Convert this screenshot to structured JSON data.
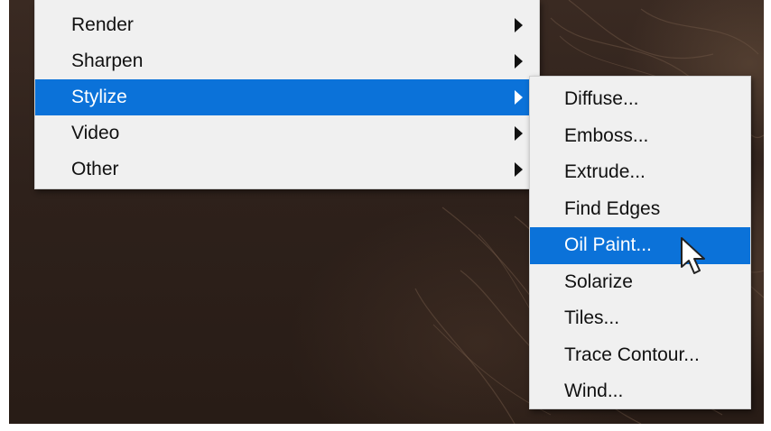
{
  "filter_menu": {
    "items": [
      {
        "label": "Render",
        "has_submenu": true,
        "highlighted": false
      },
      {
        "label": "Sharpen",
        "has_submenu": true,
        "highlighted": false
      },
      {
        "label": "Stylize",
        "has_submenu": true,
        "highlighted": true
      },
      {
        "label": "Video",
        "has_submenu": true,
        "highlighted": false
      },
      {
        "label": "Other",
        "has_submenu": true,
        "highlighted": false
      }
    ]
  },
  "stylize_submenu": {
    "items": [
      {
        "label": "Diffuse...",
        "highlighted": false
      },
      {
        "label": "Emboss...",
        "highlighted": false
      },
      {
        "label": "Extrude...",
        "highlighted": false
      },
      {
        "label": "Find Edges",
        "highlighted": false
      },
      {
        "label": "Oil Paint...",
        "highlighted": true
      },
      {
        "label": "Solarize",
        "highlighted": false
      },
      {
        "label": "Tiles...",
        "highlighted": false
      },
      {
        "label": "Trace Contour...",
        "highlighted": false
      },
      {
        "label": "Wind...",
        "highlighted": false
      }
    ]
  },
  "colors": {
    "highlight": "#0b72d9",
    "menu_background": "#f0f0f0",
    "text": "#111111"
  },
  "icons": {
    "submenu_arrow": "chevron-right-icon",
    "pointer": "mouse-pointer-icon"
  }
}
